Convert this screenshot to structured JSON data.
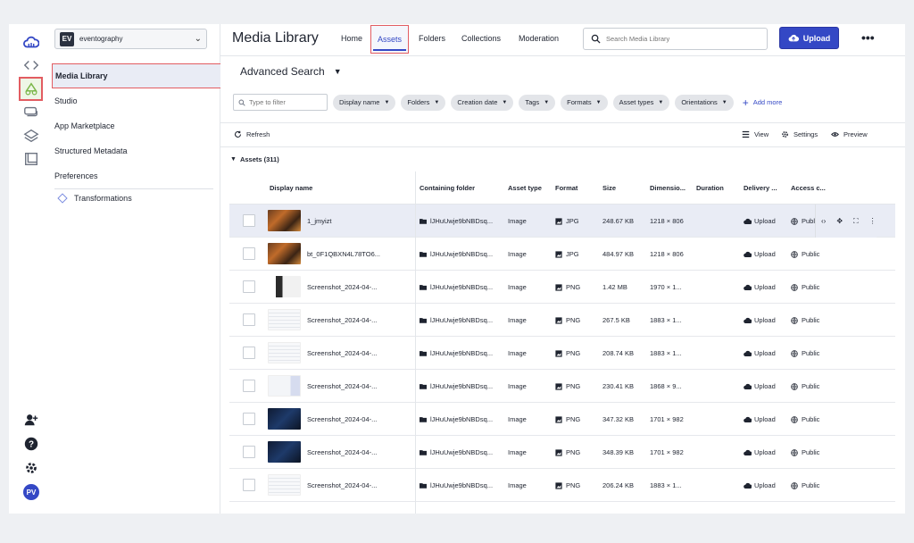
{
  "workspace": {
    "badge": "EV",
    "name": "eventography"
  },
  "rail": {
    "icons": [
      "cloud-logo-icon",
      "code-icon",
      "dam-icon",
      "messages-icon",
      "layers-icon",
      "crop-icon"
    ],
    "bottom_icons": [
      "add-user-icon",
      "help-icon",
      "settings-icon"
    ],
    "avatar": "PV"
  },
  "sidebar": {
    "items": [
      "Media Library",
      "Studio",
      "App Marketplace",
      "Structured Metadata",
      "Preferences"
    ],
    "transformations": "Transformations"
  },
  "header": {
    "title": "Media Library",
    "tabs": [
      "Home",
      "Assets",
      "Folders",
      "Collections",
      "Moderation"
    ],
    "active_tab": "Assets",
    "search_placeholder": "Search Media Library",
    "upload_label": "Upload",
    "more": "•••"
  },
  "advanced_search": "Advanced Search",
  "filters": {
    "placeholder": "Type to filter",
    "chips": [
      "Display name",
      "Folders",
      "Creation date",
      "Tags",
      "Formats",
      "Asset types",
      "Orientations"
    ],
    "add_more": "Add more"
  },
  "toolbar": {
    "refresh": "Refresh",
    "view": "View",
    "settings": "Settings",
    "preview": "Preview"
  },
  "assets_header": "Assets (311)",
  "columns": [
    "Display name",
    "Containing folder",
    "Asset type",
    "Format",
    "Size",
    "Dimensio...",
    "Duration",
    "Delivery ...",
    "Access c..."
  ],
  "rows": [
    {
      "name": "1_jmyizt",
      "folder": "lJHuUwje9bNBDsq...",
      "type": "Image",
      "format": "JPG",
      "size": "248.67 KB",
      "dims": "1218 × 806",
      "duration": "",
      "delivery": "Upload",
      "access": "Public"
    },
    {
      "name": "bt_0F1QBXN4L78TO6...",
      "folder": "lJHuUwje9bNBDsq...",
      "type": "Image",
      "format": "JPG",
      "size": "484.97 KB",
      "dims": "1218 × 806",
      "duration": "",
      "delivery": "Upload",
      "access": "Public"
    },
    {
      "name": "Screenshot_2024-04-...",
      "folder": "lJHuUwje9bNBDsq...",
      "type": "Image",
      "format": "PNG",
      "size": "1.42 MB",
      "dims": "1970 × 1...",
      "duration": "",
      "delivery": "Upload",
      "access": "Public"
    },
    {
      "name": "Screenshot_2024-04-...",
      "folder": "lJHuUwje9bNBDsq...",
      "type": "Image",
      "format": "PNG",
      "size": "267.5 KB",
      "dims": "1883 × 1...",
      "duration": "",
      "delivery": "Upload",
      "access": "Public"
    },
    {
      "name": "Screenshot_2024-04-...",
      "folder": "lJHuUwje9bNBDsq...",
      "type": "Image",
      "format": "PNG",
      "size": "208.74 KB",
      "dims": "1883 × 1...",
      "duration": "",
      "delivery": "Upload",
      "access": "Public"
    },
    {
      "name": "Screenshot_2024-04-...",
      "folder": "lJHuUwje9bNBDsq...",
      "type": "Image",
      "format": "PNG",
      "size": "230.41 KB",
      "dims": "1868 × 9...",
      "duration": "",
      "delivery": "Upload",
      "access": "Public"
    },
    {
      "name": "Screenshot_2024-04-...",
      "folder": "lJHuUwje9bNBDsq...",
      "type": "Image",
      "format": "PNG",
      "size": "347.32 KB",
      "dims": "1701 × 982",
      "duration": "",
      "delivery": "Upload",
      "access": "Public"
    },
    {
      "name": "Screenshot_2024-04-...",
      "folder": "lJHuUwje9bNBDsq...",
      "type": "Image",
      "format": "PNG",
      "size": "348.39 KB",
      "dims": "1701 × 982",
      "duration": "",
      "delivery": "Upload",
      "access": "Public"
    },
    {
      "name": "Screenshot_2024-04-...",
      "folder": "lJHuUwje9bNBDsq...",
      "type": "Image",
      "format": "PNG",
      "size": "206.24 KB",
      "dims": "1883 × 1...",
      "duration": "",
      "delivery": "Upload",
      "access": "Public"
    }
  ],
  "row_actions": [
    "code-icon",
    "move-icon",
    "expand-icon",
    "more-icon"
  ],
  "colors": {
    "accent": "#3448c5",
    "highlight_border": "#e25c61",
    "selected_row": "#e9ecf5"
  }
}
